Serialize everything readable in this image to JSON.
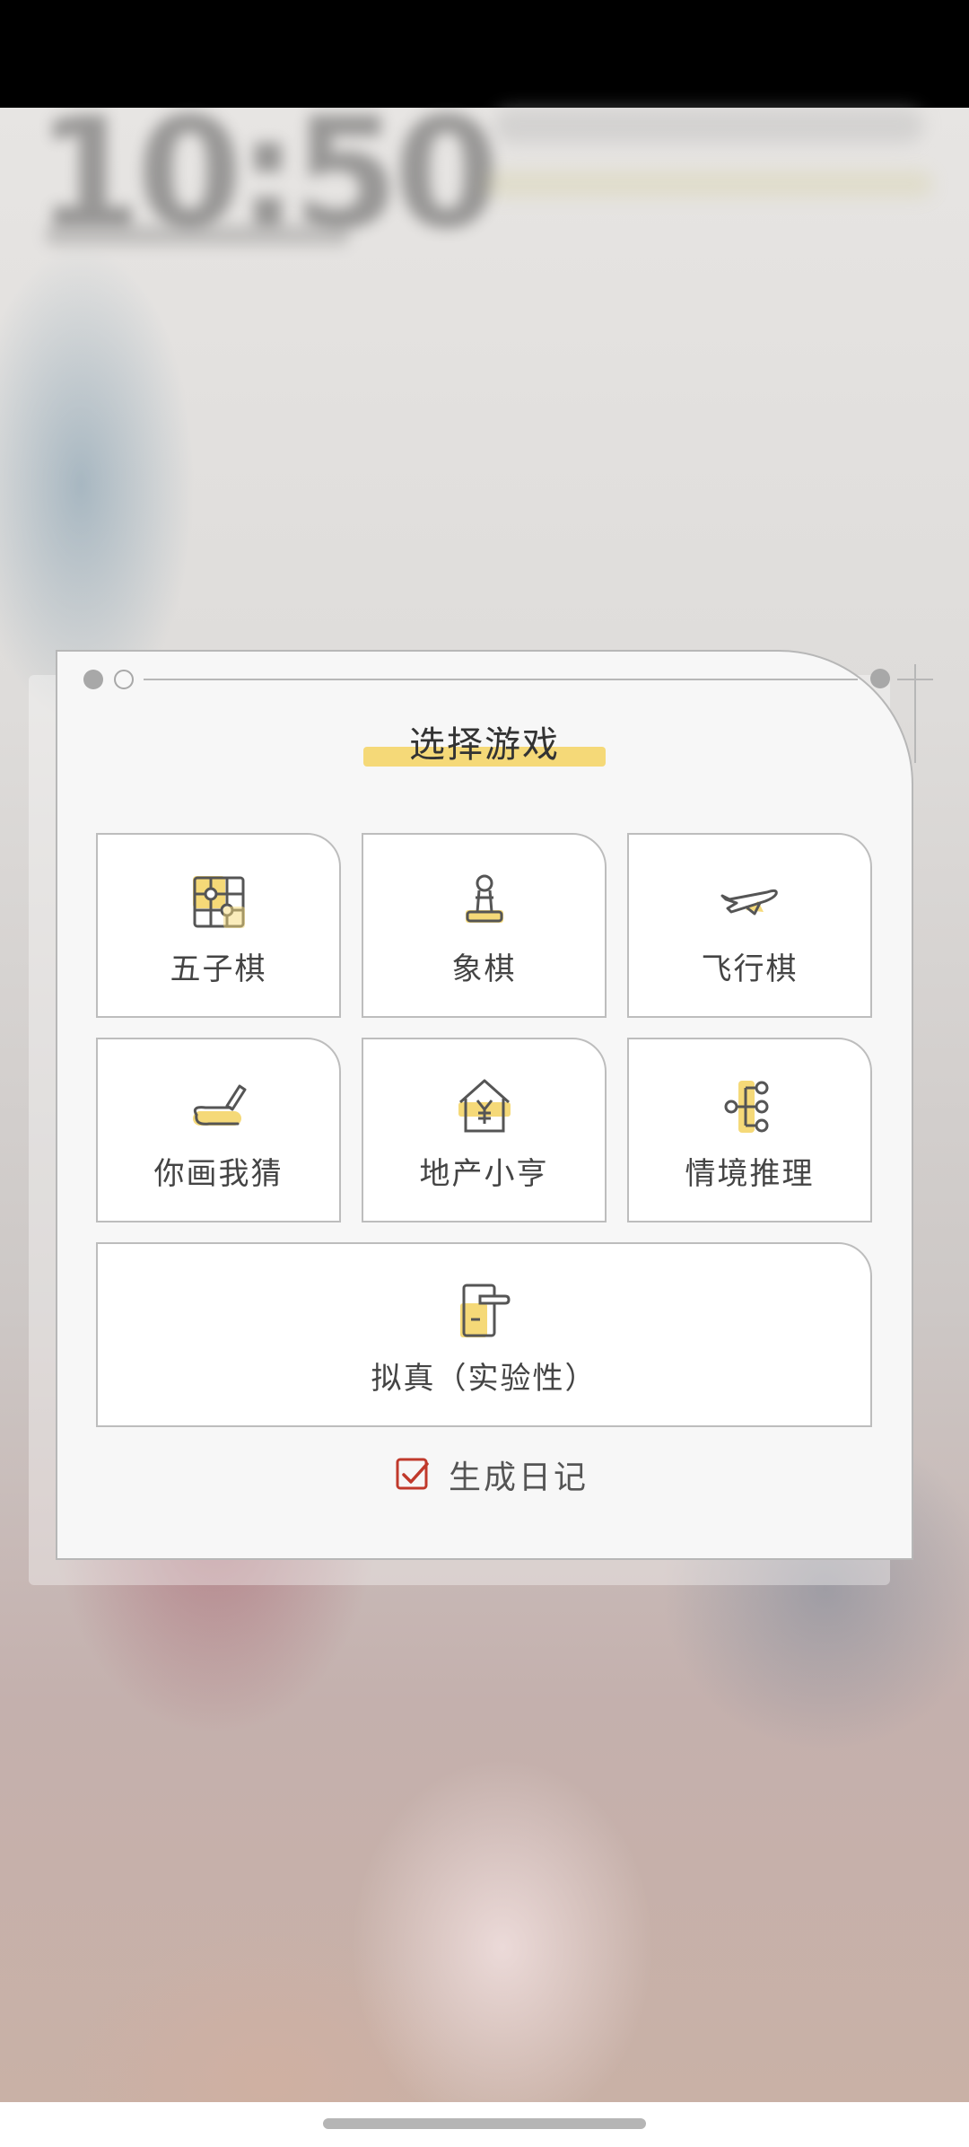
{
  "dialog": {
    "title": "选择游戏",
    "games": [
      {
        "label": "五子棋",
        "icon": "gomoku-board-icon"
      },
      {
        "label": "象棋",
        "icon": "chess-pawn-icon"
      },
      {
        "label": "飞行棋",
        "icon": "airplane-icon"
      },
      {
        "label": "你画我猜",
        "icon": "pencil-draw-icon"
      },
      {
        "label": "地产小亨",
        "icon": "house-yen-icon"
      },
      {
        "label": "情境推理",
        "icon": "branch-tree-icon"
      },
      {
        "label": "拟真（实验性）",
        "icon": "door-handle-icon"
      }
    ],
    "diary": {
      "label": "生成日记",
      "checked": true
    }
  },
  "colors": {
    "accent": "#f5d978",
    "checkbox": "#c0392b",
    "border": "#b7b7b7"
  }
}
